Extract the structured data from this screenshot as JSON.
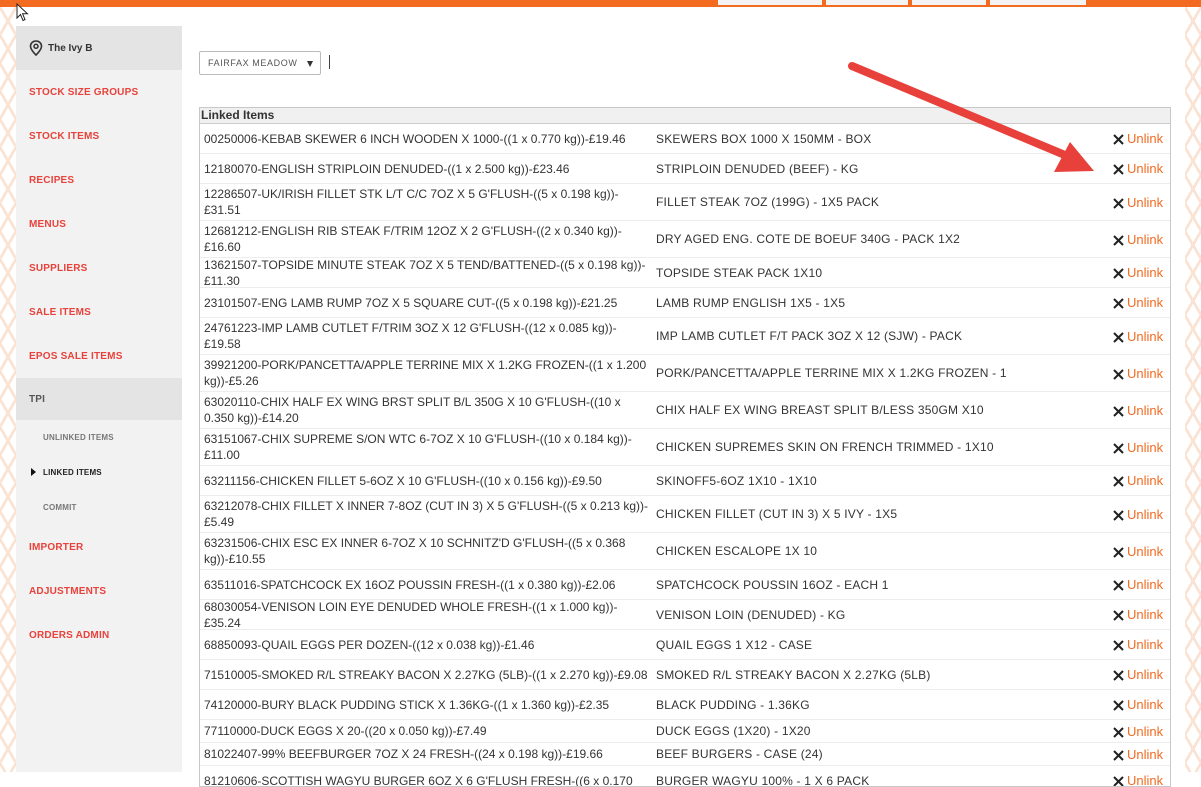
{
  "location": {
    "name": "The Ivy B"
  },
  "nav": {
    "items": [
      "STOCK SIZE GROUPS",
      "STOCK ITEMS",
      "RECIPES",
      "MENUS",
      "SUPPLIERS",
      "SALE ITEMS",
      "EPOS SALE ITEMS",
      "TPI"
    ],
    "sub_items": [
      "UNLINKED ITEMS",
      "LINKED ITEMS",
      "COMMIT"
    ],
    "after_items": [
      "IMPORTER",
      "ADJUSTMENTS",
      "ORDERS ADMIN"
    ]
  },
  "filter": {
    "supplier": "FAIRFAX MEADOW"
  },
  "table": {
    "header": "Linked Items",
    "unlink_label": "Unlink",
    "rows": [
      {
        "supplier_item": "00250006-KEBAB SKEWER 6 INCH WOODEN X 1000-((1 x 0.770 kg))-£19.46",
        "stock_item": "SKEWERS BOX 1000 X 150MM - BOX"
      },
      {
        "supplier_item": "12180070-ENGLISH STRIPLOIN DENUDED-((1 x 2.500 kg))-£23.46",
        "stock_item": "STRIPLOIN DENUDED (BEEF) - KG"
      },
      {
        "supplier_item": "12286507-UK/IRISH FILLET STK L/T C/C 7OZ X 5 G'FLUSH-((5 x 0.198 kg))-£31.51",
        "stock_item": "FILLET STEAK 7OZ (199G) - 1X5 PACK"
      },
      {
        "supplier_item": "12681212-ENGLISH RIB STEAK F/TRIM 12OZ X 2 G'FLUSH-((2 x 0.340 kg))-£16.60",
        "stock_item": "DRY AGED ENG. COTE DE BOEUF 340G - PACK 1X2"
      },
      {
        "supplier_item": "13621507-TOPSIDE MINUTE STEAK 7OZ X 5 TEND/BATTENED-((5 x 0.198 kg))-£11.30",
        "stock_item": "TOPSIDE STEAK PACK 1X10"
      },
      {
        "supplier_item": "23101507-ENG LAMB RUMP 7OZ X 5 SQUARE CUT-((5 x 0.198 kg))-£21.25",
        "stock_item": "LAMB RUMP ENGLISH 1X5 - 1X5"
      },
      {
        "supplier_item": "24761223-IMP LAMB CUTLET F/TRIM 3OZ X 12 G'FLUSH-((12 x 0.085 kg))-£19.58",
        "stock_item": "IMP LAMB CUTLET F/T PACK 3OZ X 12 (SJW) - PACK"
      },
      {
        "supplier_item": "39921200-PORK/PANCETTA/APPLE TERRINE MIX X 1.2KG FROZEN-((1 x 1.200 kg))-£5.26",
        "stock_item": "PORK/PANCETTA/APPLE TERRINE MIX X 1.2KG FROZEN - 1"
      },
      {
        "supplier_item": "63020110-CHIX HALF EX WING BRST SPLIT B/L 350G X 10 G'FLUSH-((10 x 0.350 kg))-£14.20",
        "stock_item": "CHIX HALF EX WING BREAST SPLIT B/LESS 350GM X10"
      },
      {
        "supplier_item": "63151067-CHIX SUPREME S/ON WTC 6-7OZ X 10 G'FLUSH-((10 x 0.184 kg))-£11.00",
        "stock_item": "CHICKEN SUPREMES SKIN ON FRENCH TRIMMED - 1X10"
      },
      {
        "supplier_item": "63211156-CHICKEN FILLET 5-6OZ X 10 G'FLUSH-((10 x 0.156 kg))-£9.50",
        "stock_item": "SKINOFF5-6OZ 1X10 - 1X10"
      },
      {
        "supplier_item": "63212078-CHIX FILLET X INNER 7-8OZ (CUT IN 3) X 5 G'FLUSH-((5 x 0.213 kg))-£5.49",
        "stock_item": "CHICKEN FILLET (CUT IN 3) X 5 IVY - 1X5"
      },
      {
        "supplier_item": "63231506-CHIX ESC EX INNER 6-7OZ X 10 SCHNITZ'D G'FLUSH-((5 x 0.368 kg))-£10.55",
        "stock_item": "CHICKEN ESCALOPE 1X 10"
      },
      {
        "supplier_item": "63511016-SPATCHCOCK EX 16OZ POUSSIN FRESH-((1 x 0.380 kg))-£2.06",
        "stock_item": "SPATCHCOCK POUSSIN 16OZ - EACH 1"
      },
      {
        "supplier_item": "68030054-VENISON LOIN EYE DENUDED WHOLE FRESH-((1 x 1.000 kg))-£35.24",
        "stock_item": "VENISON LOIN (DENUDED) - KG"
      },
      {
        "supplier_item": "68850093-QUAIL EGGS PER DOZEN-((12 x 0.038 kg))-£1.46",
        "stock_item": "QUAIL EGGS 1 X12 - CASE"
      },
      {
        "supplier_item": "71510005-SMOKED R/L STREAKY BACON X 2.27KG (5LB)-((1 x 2.270 kg))-£9.08",
        "stock_item": "SMOKED R/L STREAKY BACON X 2.27KG (5LB)"
      },
      {
        "supplier_item": "74120000-BURY BLACK PUDDING STICK X 1.36KG-((1 x 1.360 kg))-£2.35",
        "stock_item": "BLACK PUDDING - 1.36KG"
      },
      {
        "supplier_item": "77110000-DUCK EGGS X 20-((20 x 0.050 kg))-£7.49",
        "stock_item": "DUCK EGGS (1X20) - 1X20"
      },
      {
        "supplier_item": "81022407-99% BEEFBURGER 7OZ X 24 FRESH-((24 x 0.198 kg))-£19.66",
        "stock_item": "BEEF BURGERS - CASE (24)"
      },
      {
        "supplier_item": "81210606-SCOTTISH WAGYU BURGER 6OZ X 6 G'FLUSH FRESH-((6 x 0.170",
        "stock_item": "BURGER WAGYU 100% - 1 X 6 PACK"
      }
    ]
  },
  "colors": {
    "accent": "#f26b21",
    "nav_red": "#e8423b",
    "annotation_arrow": "#e8403a"
  }
}
